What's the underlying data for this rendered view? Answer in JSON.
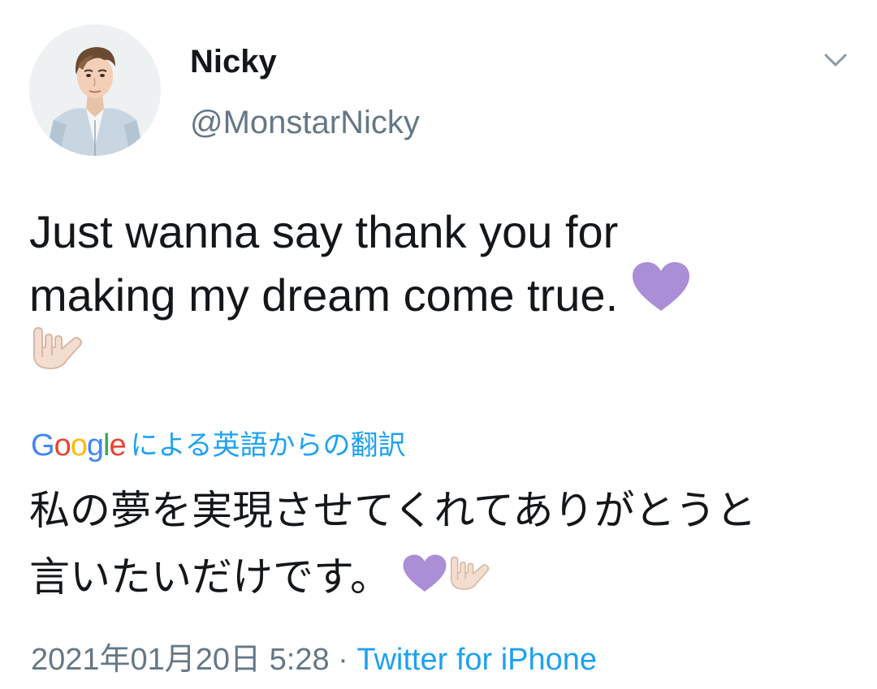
{
  "user": {
    "display_name": "Nicky",
    "handle": "@MonstarNicky",
    "avatar_icon": "profile-photo"
  },
  "menu": {
    "icon": "chevron-down-icon"
  },
  "tweet": {
    "line1": "Just wanna say thank you for",
    "line2": "making my dream come true.",
    "emoji": [
      "purple-heart",
      "love-you-gesture"
    ]
  },
  "translation": {
    "provider": "Google",
    "label": "による英語からの翻訳",
    "line1": "私の夢を実現させてくれてありがとうと",
    "line2": "言いたいだけです。"
  },
  "meta": {
    "timestamp": "2021年01月20日 5:28",
    "separator": "·",
    "source": "Twitter for iPhone"
  },
  "colors": {
    "text": "#14171a",
    "secondary": "#657786",
    "link": "#1da1f2",
    "heart": "#aa8ed6",
    "google_blue": "#4285f4",
    "google_red": "#ea4335",
    "google_yellow": "#fbbc05",
    "google_green": "#34a853"
  }
}
